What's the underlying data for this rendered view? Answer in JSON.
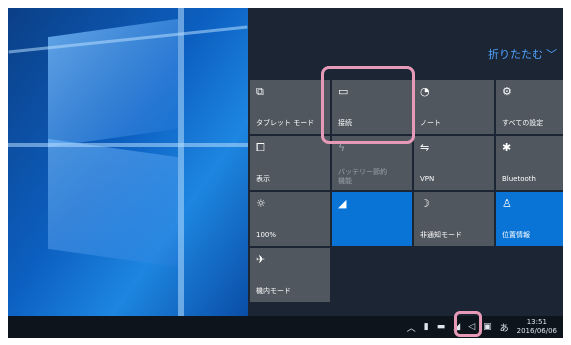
{
  "action_center": {
    "collapse_label": "折りたたむ",
    "tiles": [
      {
        "label": "タブレット モード",
        "icon": "tablet-mode-icon",
        "state": "off"
      },
      {
        "label": "接続",
        "icon": "connect-icon",
        "state": "off"
      },
      {
        "label": "ノート",
        "icon": "note-icon",
        "state": "off"
      },
      {
        "label": "すべての設定",
        "icon": "settings-icon",
        "state": "off"
      },
      {
        "label": "表示",
        "icon": "project-icon",
        "state": "off"
      },
      {
        "label": "バッテリー節約機能",
        "icon": "battery-saver-icon",
        "state": "disabled"
      },
      {
        "label": "VPN",
        "icon": "vpn-icon",
        "state": "off"
      },
      {
        "label": "Bluetooth",
        "icon": "bluetooth-icon",
        "state": "off"
      },
      {
        "label": "100%",
        "icon": "brightness-icon",
        "state": "off"
      },
      {
        "label": "",
        "icon": "wifi-icon",
        "state": "on"
      },
      {
        "label": "非通知モード",
        "icon": "quiet-hours-icon",
        "state": "off"
      },
      {
        "label": "位置情報",
        "icon": "location-icon",
        "state": "on"
      },
      {
        "label": "機内モード",
        "icon": "airplane-mode-icon",
        "state": "off"
      }
    ]
  },
  "taskbar": {
    "time": "13:51",
    "date": "2016/06/06"
  },
  "colors": {
    "accent": "#0a74d6",
    "tile": "#50575f",
    "highlight": "#e79ab8"
  }
}
